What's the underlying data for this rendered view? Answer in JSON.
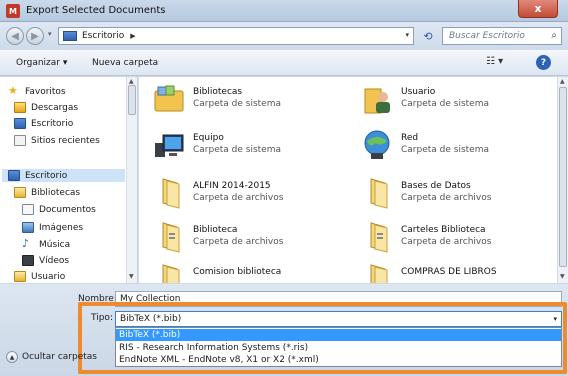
{
  "window": {
    "app_icon": "M",
    "title": "Export Selected Documents",
    "close_label": "x"
  },
  "address": {
    "back_icon": "back-arrow-icon",
    "forward_icon": "forward-arrow-icon",
    "path": "Escritorio",
    "search_placeholder": "Buscar Escritorio"
  },
  "toolbar": {
    "organize": "Organizar ▾",
    "new_folder": "Nueva carpeta",
    "help": "?"
  },
  "nav": {
    "items": [
      {
        "label": "Favoritos",
        "icon": "star-icon"
      },
      {
        "label": "Descargas",
        "icon": "downloads-icon"
      },
      {
        "label": "Escritorio",
        "icon": "desktop-icon"
      },
      {
        "label": "Sitios recientes",
        "icon": "recent-places-icon"
      },
      {
        "label": "Escritorio",
        "icon": "desktop-icon"
      },
      {
        "label": "Bibliotecas",
        "icon": "libraries-icon"
      },
      {
        "label": "Documentos",
        "icon": "documents-icon"
      },
      {
        "label": "Imágenes",
        "icon": "pictures-icon"
      },
      {
        "label": "Música",
        "icon": "music-icon"
      },
      {
        "label": "Vídeos",
        "icon": "videos-icon"
      },
      {
        "label": "Usuario",
        "icon": "user-icon"
      }
    ]
  },
  "files": [
    {
      "name": "Bibliotecas",
      "type": "Carpeta de sistema",
      "icon": "libraries-icon"
    },
    {
      "name": "Usuario",
      "type": "Carpeta de sistema",
      "icon": "user-folder-icon"
    },
    {
      "name": "Equipo",
      "type": "Carpeta de sistema",
      "icon": "computer-icon"
    },
    {
      "name": "Red",
      "type": "Carpeta de sistema",
      "icon": "network-icon"
    },
    {
      "name": "ALFIN 2014-2015",
      "type": "Carpeta de archivos",
      "icon": "folder-icon"
    },
    {
      "name": "Bases de Datos",
      "type": "Carpeta de archivos",
      "icon": "folder-icon"
    },
    {
      "name": "Biblioteca",
      "type": "Carpeta de archivos",
      "icon": "folder-icon"
    },
    {
      "name": "Carteles Biblioteca",
      "type": "Carpeta de archivos",
      "icon": "folder-icon"
    },
    {
      "name": "Comision biblioteca",
      "type": "",
      "icon": "folder-icon"
    },
    {
      "name": "COMPRAS DE LIBROS",
      "type": "",
      "icon": "folder-icon"
    }
  ],
  "form": {
    "name_label": "Nombre:",
    "name_value": "My Collection",
    "type_label": "Tipo:",
    "type_value": "BibTeX (*.bib)",
    "type_options": [
      "BibTeX (*.bib)",
      "RIS - Research Information Systems (*.ris)",
      "EndNote XML - EndNote v8, X1 or X2 (*.xml)"
    ],
    "hide_folders": "Ocultar carpetas"
  },
  "colors": {
    "highlight_frame": "#ee8a2f",
    "selection": "#3399ff"
  }
}
